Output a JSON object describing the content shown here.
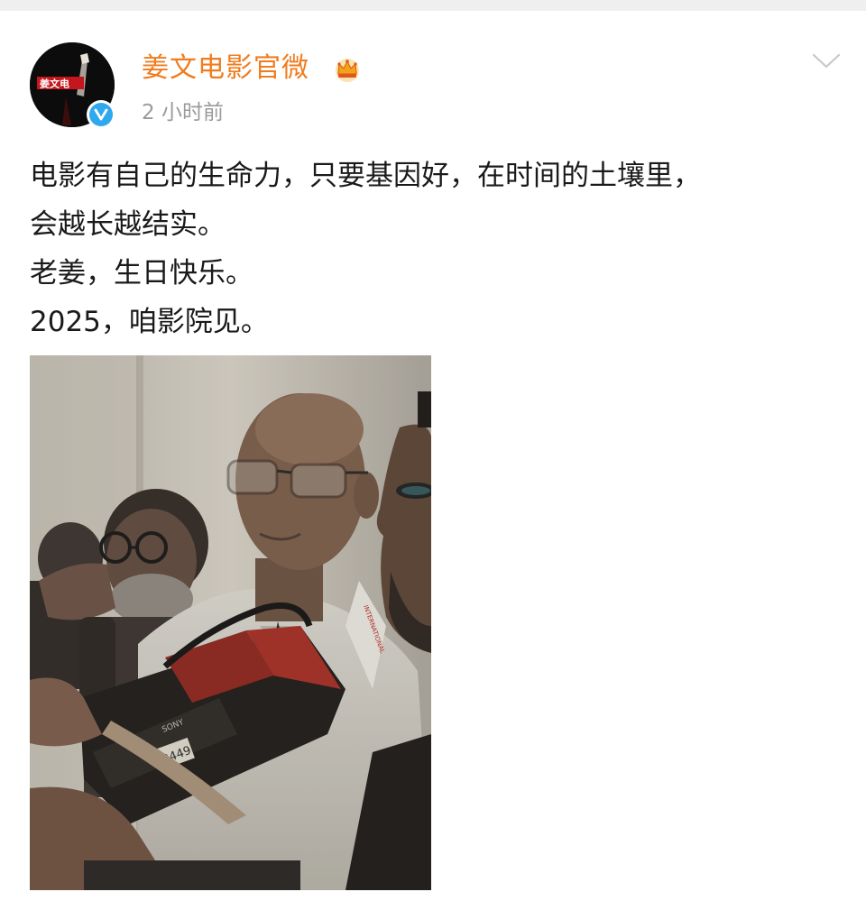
{
  "post": {
    "author": "姜文电影官微",
    "timestamp": "2 小时前",
    "lines": [
      "电影有自己的生命力，只要基因好，在时间的土壤里，",
      "会越长越结实。",
      "老姜，生日快乐。",
      "2025，咱影院见。"
    ],
    "avatar_logo_text": "姜文电",
    "camera_tape_label": "B449",
    "camera_brand": "SONY"
  },
  "icons": {
    "verified": "verified-badge-icon",
    "member": "crown-icon",
    "menu": "chevron-down-icon"
  },
  "colors": {
    "author_name": "#f07c1e",
    "timestamp": "#9b9b9b",
    "body_text": "#1a1a1a",
    "verified_badge": "#2fa8ee",
    "chevron": "#c8c8c8"
  }
}
